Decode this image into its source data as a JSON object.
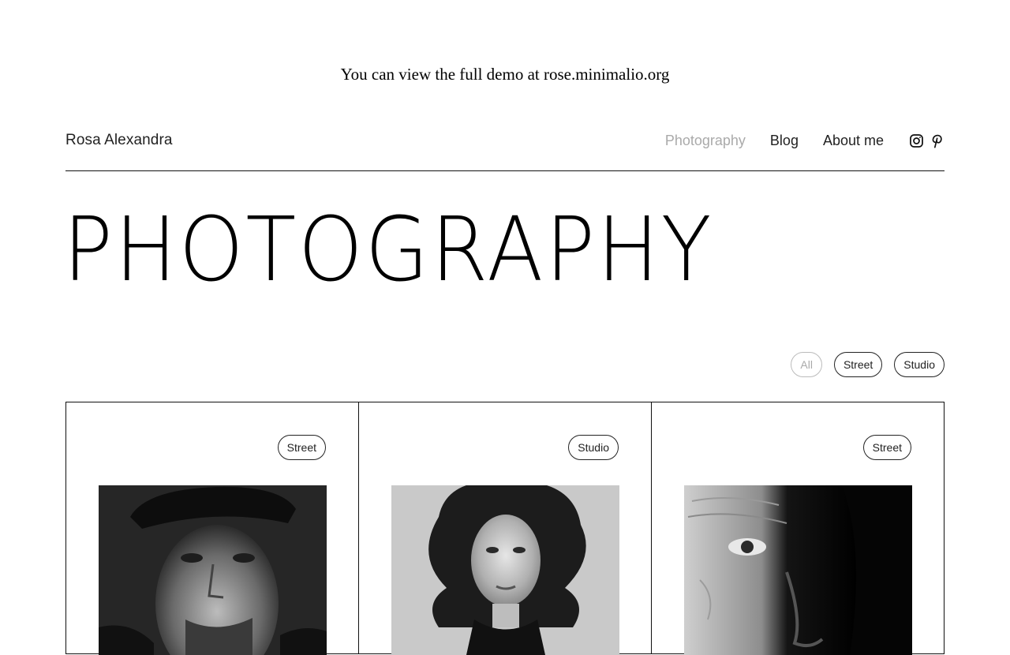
{
  "banner": {
    "text": "You can view the full demo at rose.minimalio.org"
  },
  "header": {
    "site_name": "Rosa Alexandra",
    "nav": [
      {
        "label": "Photography",
        "active": true
      },
      {
        "label": "Blog",
        "active": false
      },
      {
        "label": "About me",
        "active": false
      }
    ],
    "social": [
      {
        "icon": "instagram-icon"
      },
      {
        "icon": "pinterest-icon"
      }
    ]
  },
  "page": {
    "title": "PHOTOGRAPHY"
  },
  "filters": [
    {
      "label": "All",
      "active": true
    },
    {
      "label": "Street",
      "active": false
    },
    {
      "label": "Studio",
      "active": false
    }
  ],
  "gallery": [
    {
      "category": "Street",
      "subject": "Man in cap portrait"
    },
    {
      "category": "Studio",
      "subject": "Woman with curly hair portrait"
    },
    {
      "category": "Street",
      "subject": "Elderly man half-shadow portrait"
    }
  ],
  "colors": {
    "text": "#111111",
    "muted": "#aaaaaa",
    "background": "#ffffff"
  }
}
